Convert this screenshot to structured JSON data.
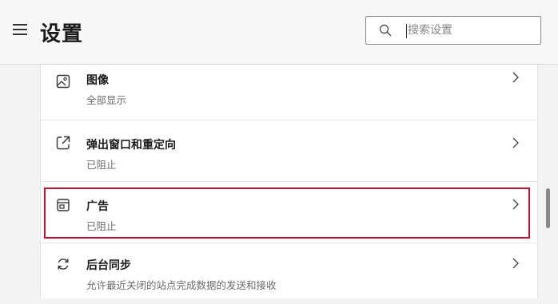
{
  "header": {
    "title": "设置",
    "search_placeholder": "搜索设置"
  },
  "settings": [
    {
      "title": "图像",
      "subtitle": "全部显示",
      "icon": "image-icon"
    },
    {
      "title": "弹出窗口和重定向",
      "subtitle": "已阻止",
      "icon": "popup-icon"
    },
    {
      "title": "广告",
      "subtitle": "已阻止",
      "icon": "ads-icon"
    },
    {
      "title": "后台同步",
      "subtitle": "允许最近关闭的站点完成数据的发送和接收",
      "icon": "sync-icon"
    }
  ],
  "colors": {
    "highlight": "#c8102e",
    "background": "#f3f3f3"
  }
}
